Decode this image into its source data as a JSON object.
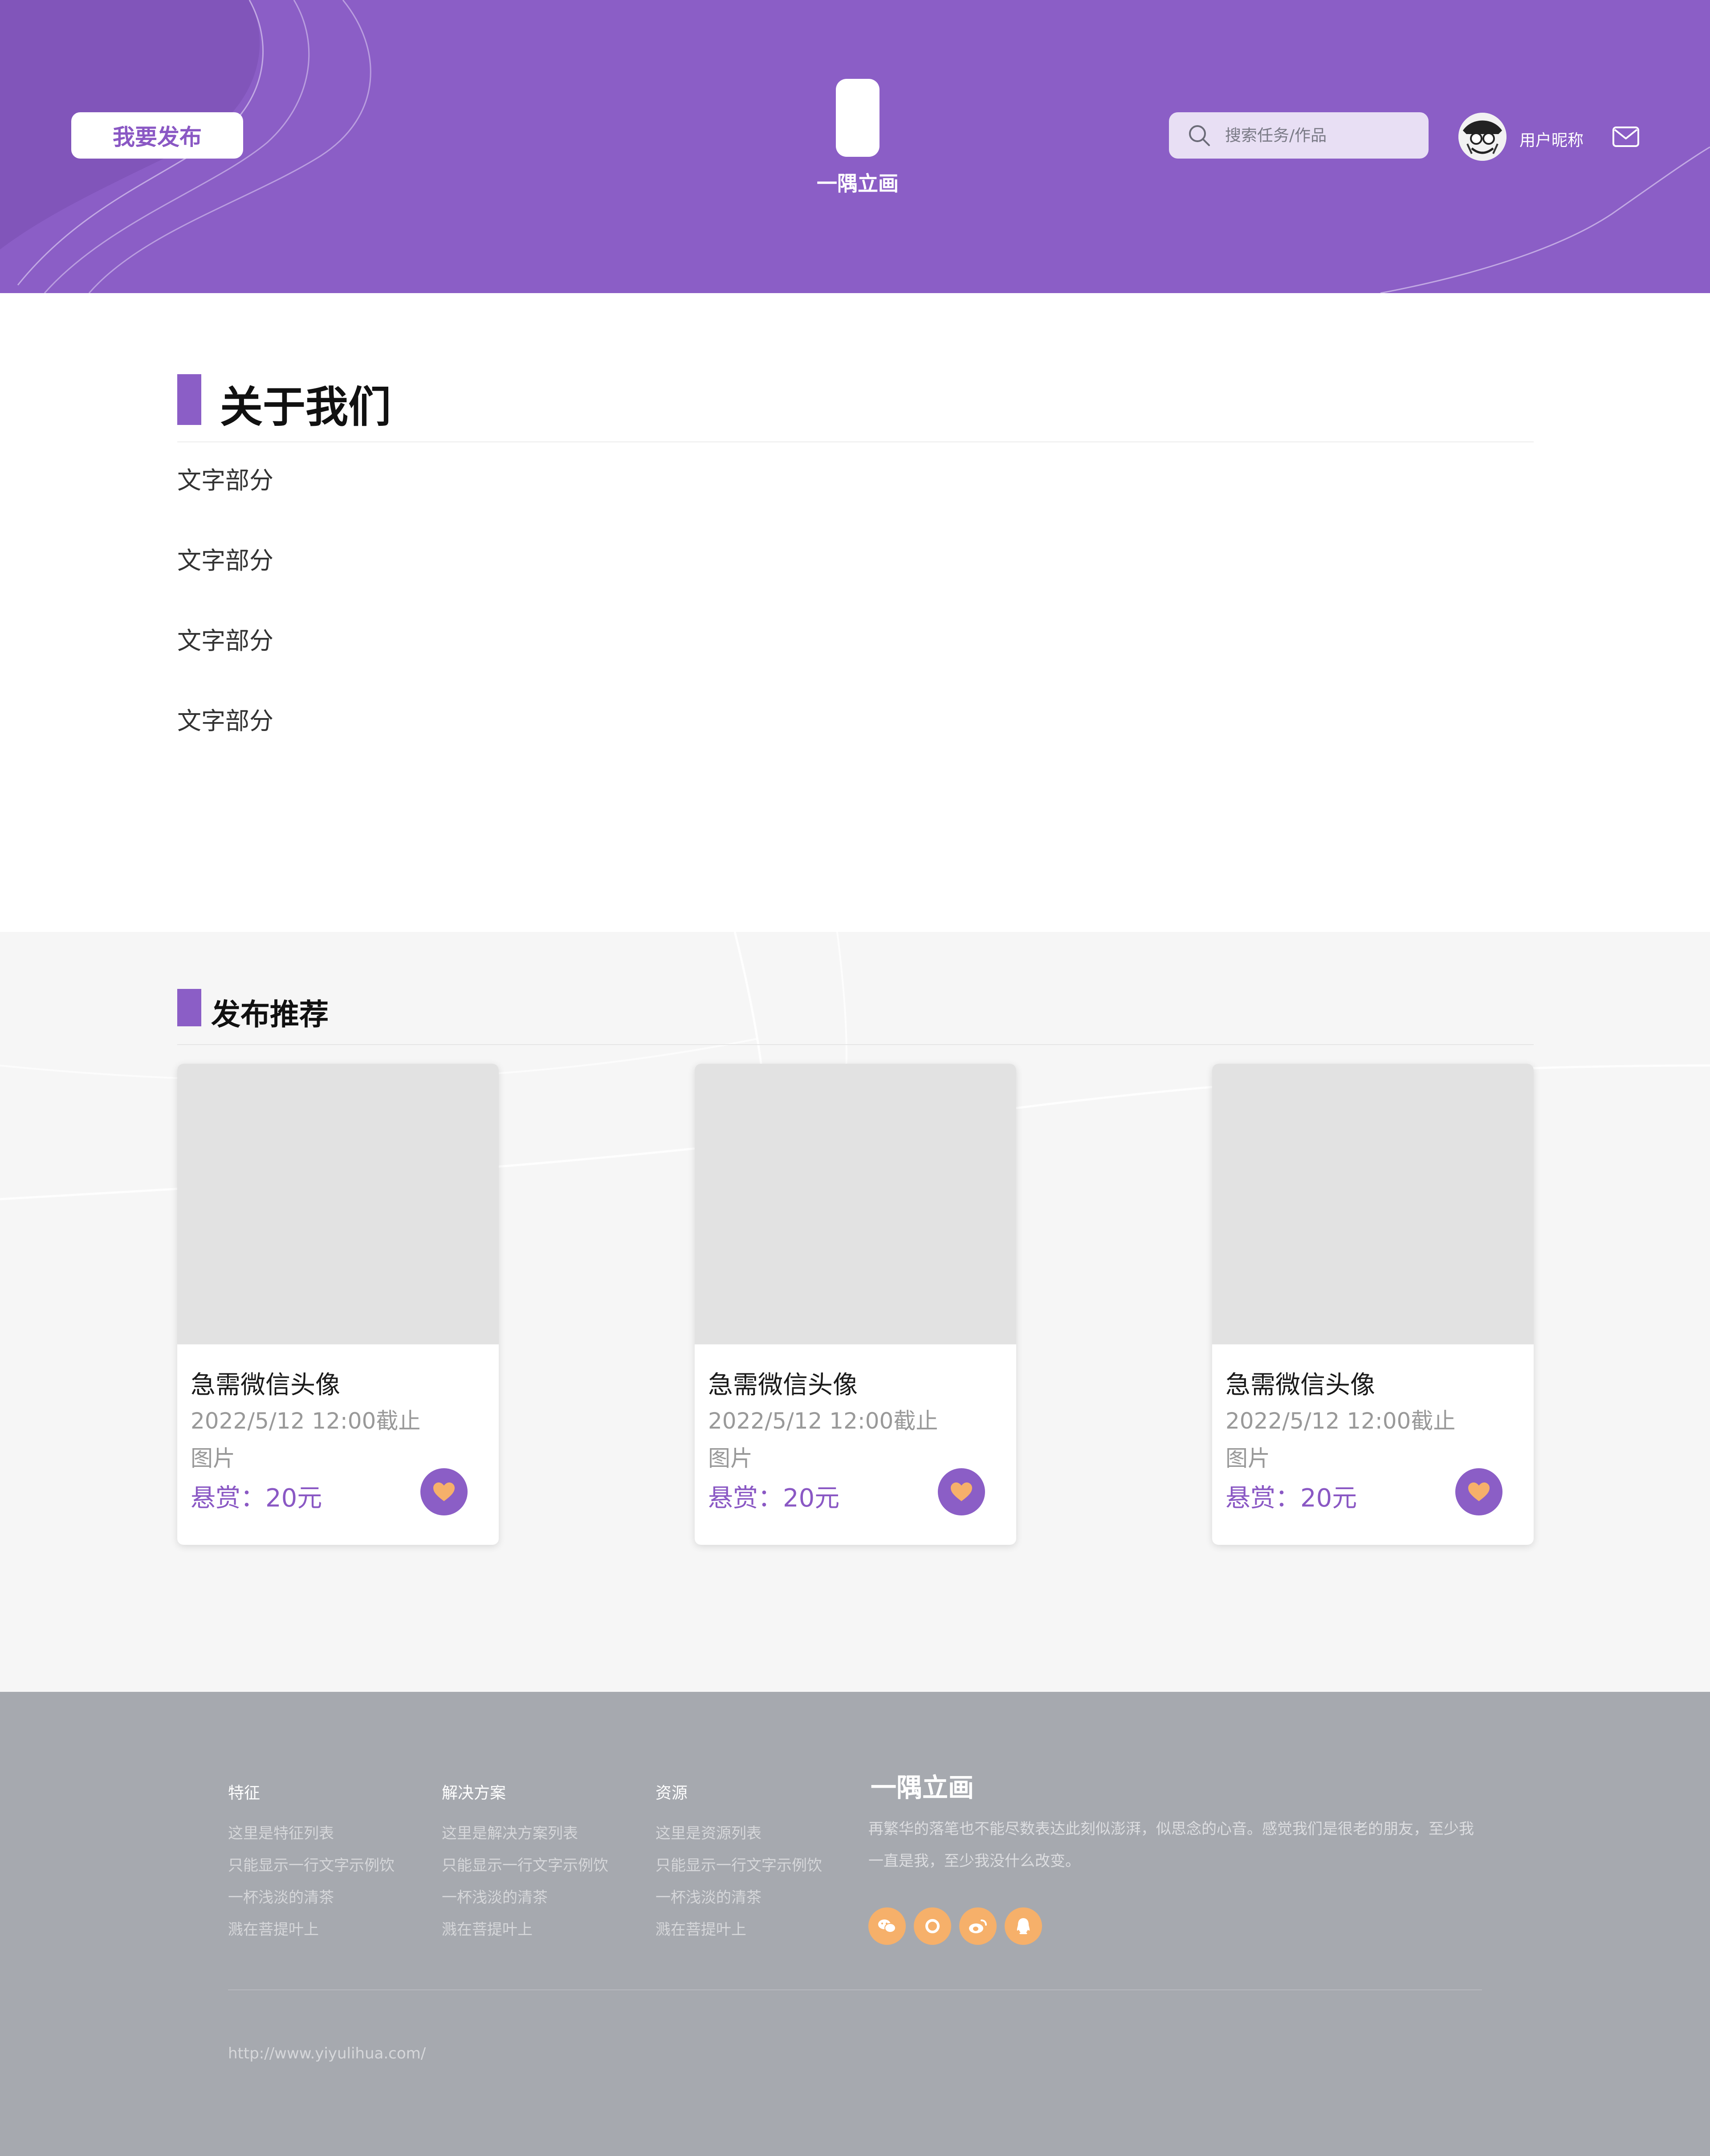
{
  "header": {
    "publish_label": "我要发布",
    "logo_text": "一隅立画",
    "search_placeholder": "搜索任务/作品",
    "username": "用户昵称",
    "icons": {
      "search": "search-icon",
      "mail": "mail-icon",
      "avatar": "avatar-image"
    },
    "bg_color": "#8b5ec6"
  },
  "about": {
    "title": "关于我们",
    "lines": [
      "文字部分",
      "文字部分",
      "文字部分",
      "文字部分"
    ]
  },
  "recommend": {
    "title": "发布推荐",
    "cards": [
      {
        "title": "急需微信头像",
        "deadline": "2022/5/12 12:00截止",
        "type": "图片",
        "reward": "悬赏：20元"
      },
      {
        "title": "急需微信头像",
        "deadline": "2022/5/12 12:00截止",
        "type": "图片",
        "reward": "悬赏：20元"
      },
      {
        "title": "急需微信头像",
        "deadline": "2022/5/12 12:00截止",
        "type": "图片",
        "reward": "悬赏：20元"
      }
    ],
    "like_icon": "heart-icon",
    "accent_color": "#8b5ec6",
    "heart_color": "#f6b06a"
  },
  "footer": {
    "columns": [
      {
        "heading": "特征",
        "items": [
          "这里是特征列表",
          "只能显示一行文字示例饮",
          "一杯浅淡的清茶",
          "溅在菩提叶上"
        ]
      },
      {
        "heading": "解决方案",
        "items": [
          "这里是解决方案列表",
          "只能显示一行文字示例饮",
          "一杯浅淡的清茶",
          "溅在菩提叶上"
        ]
      },
      {
        "heading": "资源",
        "items": [
          "这里是资源列表",
          "只能显示一行文字示例饮",
          "一杯浅淡的清茶",
          "溅在菩提叶上"
        ]
      }
    ],
    "brand_title": "一隅立画",
    "brand_desc": "再繁华的落笔也不能尽数表达此刻似澎湃，似思念的心音。感觉我们是很老的朋友，至少我一直是我，至少我没什么改变。",
    "social_icons": [
      "wechat-icon",
      "circle-icon",
      "weibo-icon",
      "qq-icon"
    ],
    "url": "http://www.yiyulihua.com/",
    "bg_color": "#a6a9af",
    "social_color": "#f6b06a"
  }
}
